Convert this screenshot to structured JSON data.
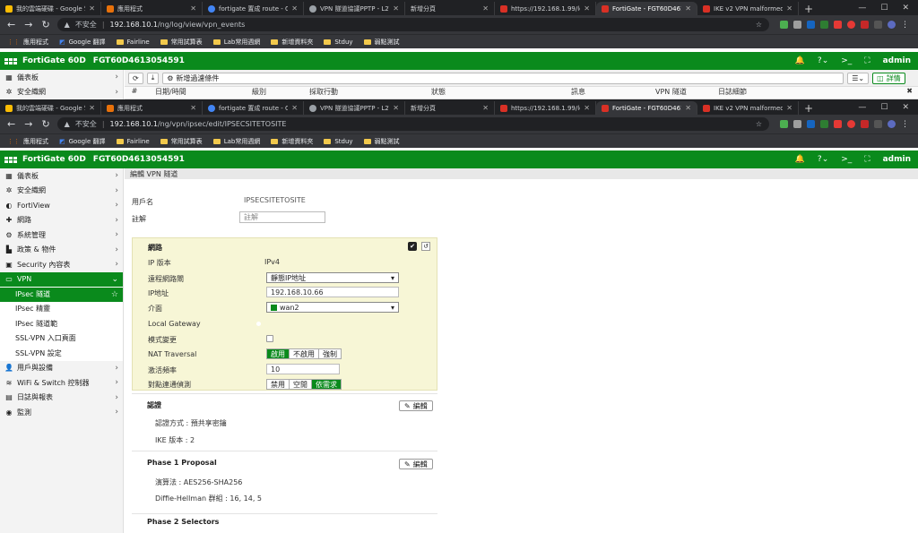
{
  "tabs": [
    {
      "label": "我的雲端硬碟 - Google 雲",
      "color": "#fbbc04"
    },
    {
      "label": "應用程式",
      "color": "#e8710a"
    },
    {
      "label": "fortigate 置成 route - Go",
      "color": "#4285f4"
    },
    {
      "label": "VPN 隧道協議PPTP - L2T",
      "color": "#9aa0a6"
    },
    {
      "label": "新增分頁",
      "color": "#35363a"
    },
    {
      "label": "https://192.168.1.99/log",
      "color": "#d93025"
    },
    {
      "label": "FortiGate - FGT60D4613",
      "color": "#d93025"
    },
    {
      "label": "IKE v2 VPN malformed",
      "color": "#d93025"
    }
  ],
  "win": {
    "min": "—",
    "max": "☐",
    "close": "✕",
    "new": "+"
  },
  "browser1": {
    "security": "不安全",
    "url": "192.168.10.1",
    "path": "/ng/log/view/vpn_events"
  },
  "browser2": {
    "security": "不安全",
    "url": "192.168.10.1",
    "path": "/ng/vpn/ipsec/edit/IPSECSITETOSITE"
  },
  "bookmarks": [
    "應用程式",
    "Google 翻譯",
    "Fairline",
    "常用試算表",
    "Lab常用週網",
    "新增資料夾",
    "Stduy",
    "弱點測試"
  ],
  "fg": {
    "product": "FortiGate 60D",
    "serial": "FGT60D4613054591",
    "admin": "admin",
    "bell_count": "1"
  },
  "log": {
    "filter_label": "新增過濾條件",
    "details": "詳情",
    "cols": [
      "#",
      "日期/時間",
      "級別",
      "採取行動",
      "狀態",
      "訊息",
      "VPN 隧道",
      "日誌細節"
    ]
  },
  "menu1": [
    "儀表板",
    "安全織網"
  ],
  "menu": [
    {
      "icon": "▦",
      "label": "儀表板",
      "chev": "›"
    },
    {
      "icon": "✲",
      "label": "安全織網",
      "chev": "›"
    },
    {
      "icon": "◐",
      "label": "FortiView",
      "chev": "›"
    },
    {
      "icon": "✚",
      "label": "網路",
      "chev": "›"
    },
    {
      "icon": "⚙",
      "label": "系統管理",
      "chev": "›"
    },
    {
      "icon": "▙",
      "label": "政策 & 物件",
      "chev": "›"
    },
    {
      "icon": "▣",
      "label": "Security 內容表",
      "chev": "›"
    },
    {
      "icon": "▭",
      "label": "VPN",
      "chev": "⌄"
    }
  ],
  "vpn_sub": [
    "IPsec 隧道",
    "IPsec 精靈",
    "IPsec 隧道範",
    "SSL-VPN 入口頁面",
    "SSL-VPN 設定"
  ],
  "menu_after": [
    {
      "icon": "👤",
      "label": "用戶與設備",
      "chev": "›"
    },
    {
      "icon": "≋",
      "label": "WiFi & Switch 控制器",
      "chev": "›"
    },
    {
      "icon": "▤",
      "label": "日誌與報表",
      "chev": "›"
    },
    {
      "icon": "◉",
      "label": "監測",
      "chev": "›"
    }
  ],
  "page": {
    "crumb": "編輯 VPN 隧道",
    "name_label": "用戶名",
    "name_value": "IPSECSITETOSITE",
    "comment_label": "註解",
    "comment_placeholder": "註解",
    "network_title": "網路",
    "ipver_label": "IP 版本",
    "ipver_value": "IPv4",
    "remote_label": "遠程網路閘",
    "remote_value": "靜態IP地址",
    "ip_label": "IP地址",
    "ip_value": "192.168.10.66",
    "iface_label": "介面",
    "iface_value": "wan2",
    "lgw_label": "Local Gateway",
    "mode_label": "模式變更",
    "nat_label": "NAT Traversal",
    "nat_opts": [
      "啟用",
      "不啟用",
      "強制"
    ],
    "keep_label": "激活頻率",
    "keep_value": "10",
    "dpd_label": "對點連通偵測",
    "dpd_opts": [
      "禁用",
      "空閒",
      "依需求"
    ],
    "auth_title": "認證",
    "edit_label": "編輯",
    "auth_method": "認證方式 : 預共享密鑰",
    "ike_ver": "IKE 版本 : 2",
    "p1_title": "Phase 1 Proposal",
    "p1_enc": "演算法 : AES256-SHA256",
    "p1_dh": "Diffie-Hellman 群組 : 16, 14, 5",
    "p2_title": "Phase 2 Selectors"
  }
}
